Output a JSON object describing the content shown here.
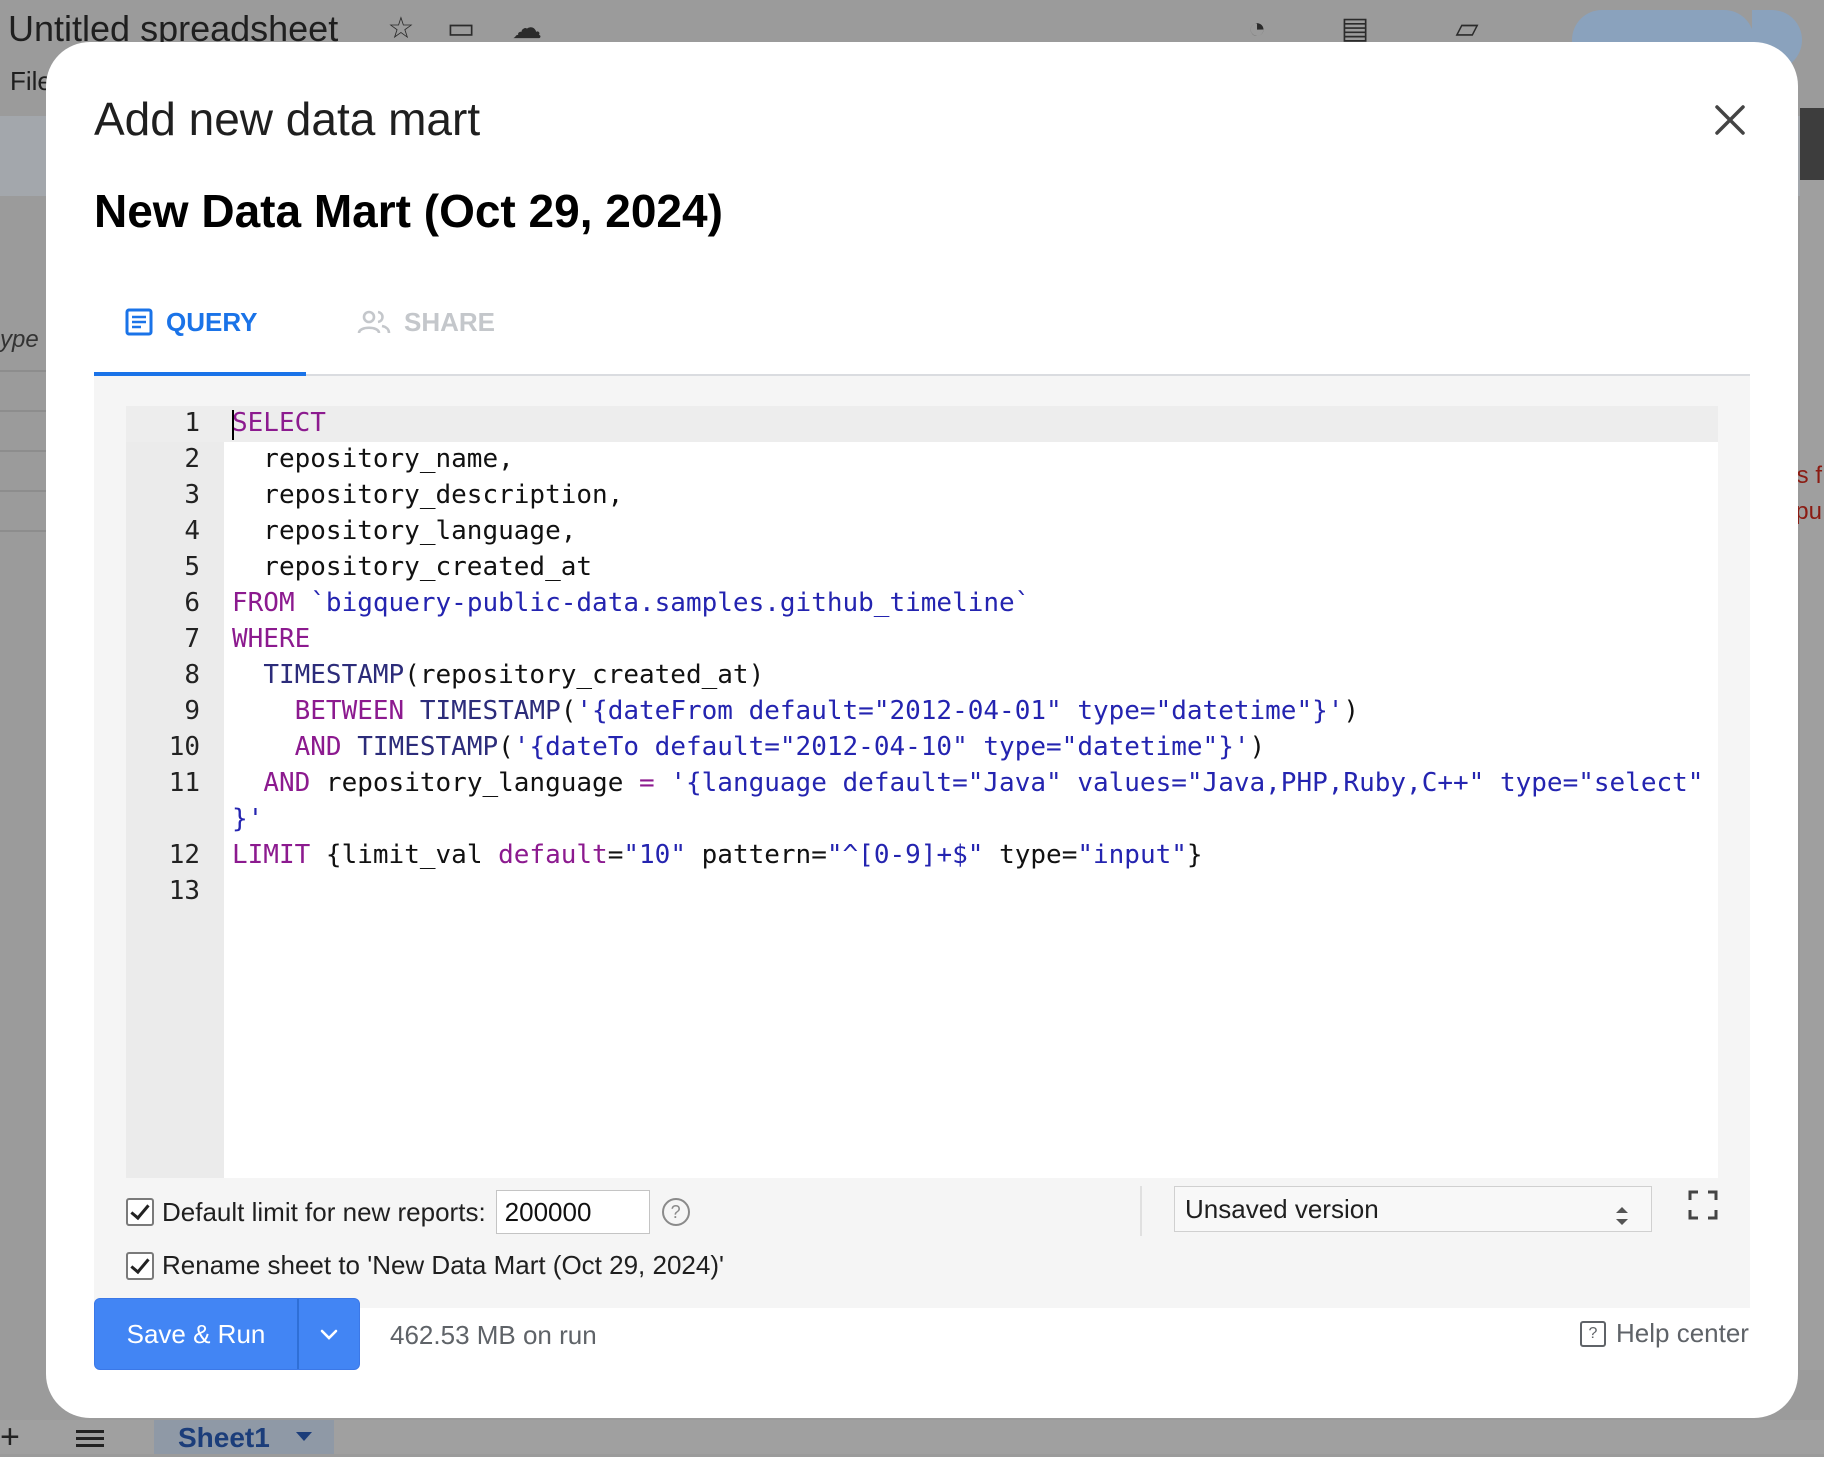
{
  "background": {
    "doc_title": "Untitled spreadsheet",
    "menu_file": "File",
    "type_fragment": "ype",
    "red_text_1": "s f",
    "red_text_2": "pu",
    "sheet_tab": "Sheet1"
  },
  "dialog": {
    "heading": "Add new data mart",
    "mart_title": "New Data Mart (Oct 29, 2024)",
    "tabs": [
      {
        "label": "QUERY",
        "active": true,
        "icon": "document-icon"
      },
      {
        "label": "SHARE",
        "active": false,
        "icon": "people-icon"
      }
    ],
    "editor": {
      "line_numbers": [
        "1",
        "2",
        "3",
        "4",
        "5",
        "6",
        "7",
        "8",
        "9",
        "10",
        "11",
        "",
        "12",
        "13"
      ]
    },
    "default_limit_label": "Default limit for new reports:",
    "default_limit_value": "200000",
    "rename_label": "Rename sheet to 'New Data Mart (Oct 29, 2024)'",
    "version_select": "Unsaved version",
    "run_button": "Save & Run",
    "size_text": "462.53 MB on run",
    "help_center": "Help center"
  },
  "colors": {
    "accent": "#1a73e8",
    "button": "#4285f4",
    "keyword": "#8c1a8f",
    "string": "#2424b0"
  }
}
